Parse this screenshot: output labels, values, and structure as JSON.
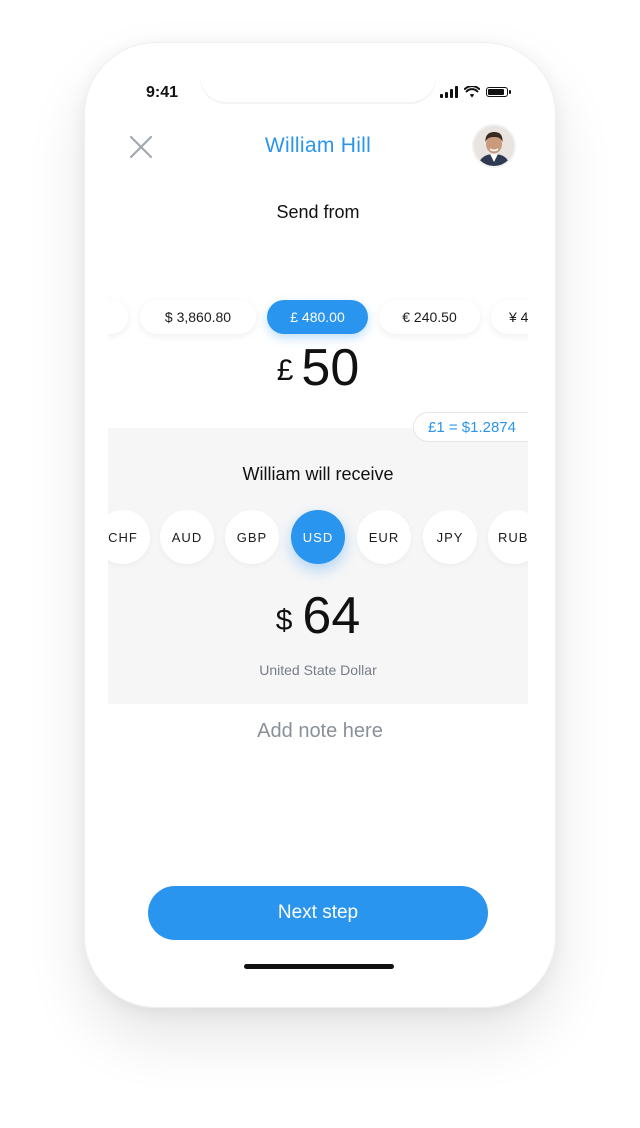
{
  "status_bar": {
    "time": "9:41"
  },
  "header": {
    "title": "William Hill"
  },
  "send": {
    "label": "Send from",
    "accounts": [
      {
        "label": ""
      },
      {
        "label": "$ 3,860.80"
      },
      {
        "label": "£ 480.00",
        "selected": true
      },
      {
        "label": "€ 240.50"
      },
      {
        "label": "¥ 4"
      }
    ],
    "amount_symbol": "£",
    "amount": "50",
    "rate": "£1 = $1.2874"
  },
  "receive": {
    "label": "William will receive",
    "currencies": [
      {
        "code": "CHF"
      },
      {
        "code": "AUD"
      },
      {
        "code": "GBP"
      },
      {
        "code": "USD",
        "selected": true
      },
      {
        "code": "EUR"
      },
      {
        "code": "JPY"
      },
      {
        "code": "RUB"
      }
    ],
    "amount_symbol": "$",
    "amount": "64",
    "currency_name": "United State Dollar"
  },
  "note": {
    "placeholder": "Add note here",
    "value": ""
  },
  "next_button": {
    "label": "Next step"
  },
  "colors": {
    "accent": "#2a95ee",
    "background": "#ffffff",
    "panel": "#f6f6f7"
  },
  "icons": {
    "close": "close-icon",
    "avatar": "avatar"
  }
}
